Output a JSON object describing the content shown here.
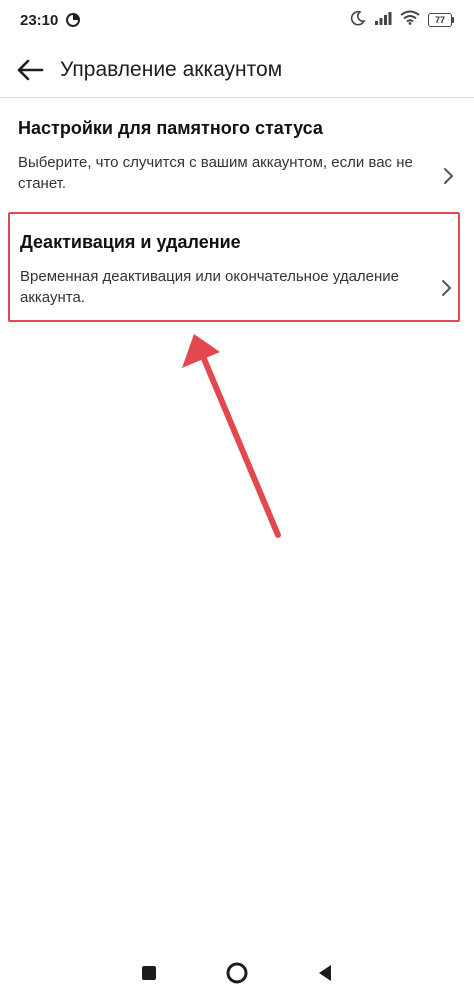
{
  "status_bar": {
    "time": "23:10",
    "battery_level": "77",
    "icons": [
      "moon-icon",
      "signal-icon",
      "wifi-icon",
      "battery-icon"
    ]
  },
  "app_bar": {
    "title": "Управление аккаунтом",
    "back_icon": "arrow-left-icon"
  },
  "items": [
    {
      "title": "Настройки для памятного статуса",
      "description": "Выберите, что случится с вашим аккаунтом, если вас не станет."
    },
    {
      "title": "Деактивация и удаление",
      "description": "Временная деактивация или окончательное удаление аккаунта."
    }
  ],
  "colors": {
    "highlight": "#e2494f",
    "text": "#1c1e21",
    "divider": "#dadde1"
  },
  "nav_bar": {
    "icons": [
      "square-recent-icon",
      "circle-home-icon",
      "triangle-back-icon"
    ]
  }
}
